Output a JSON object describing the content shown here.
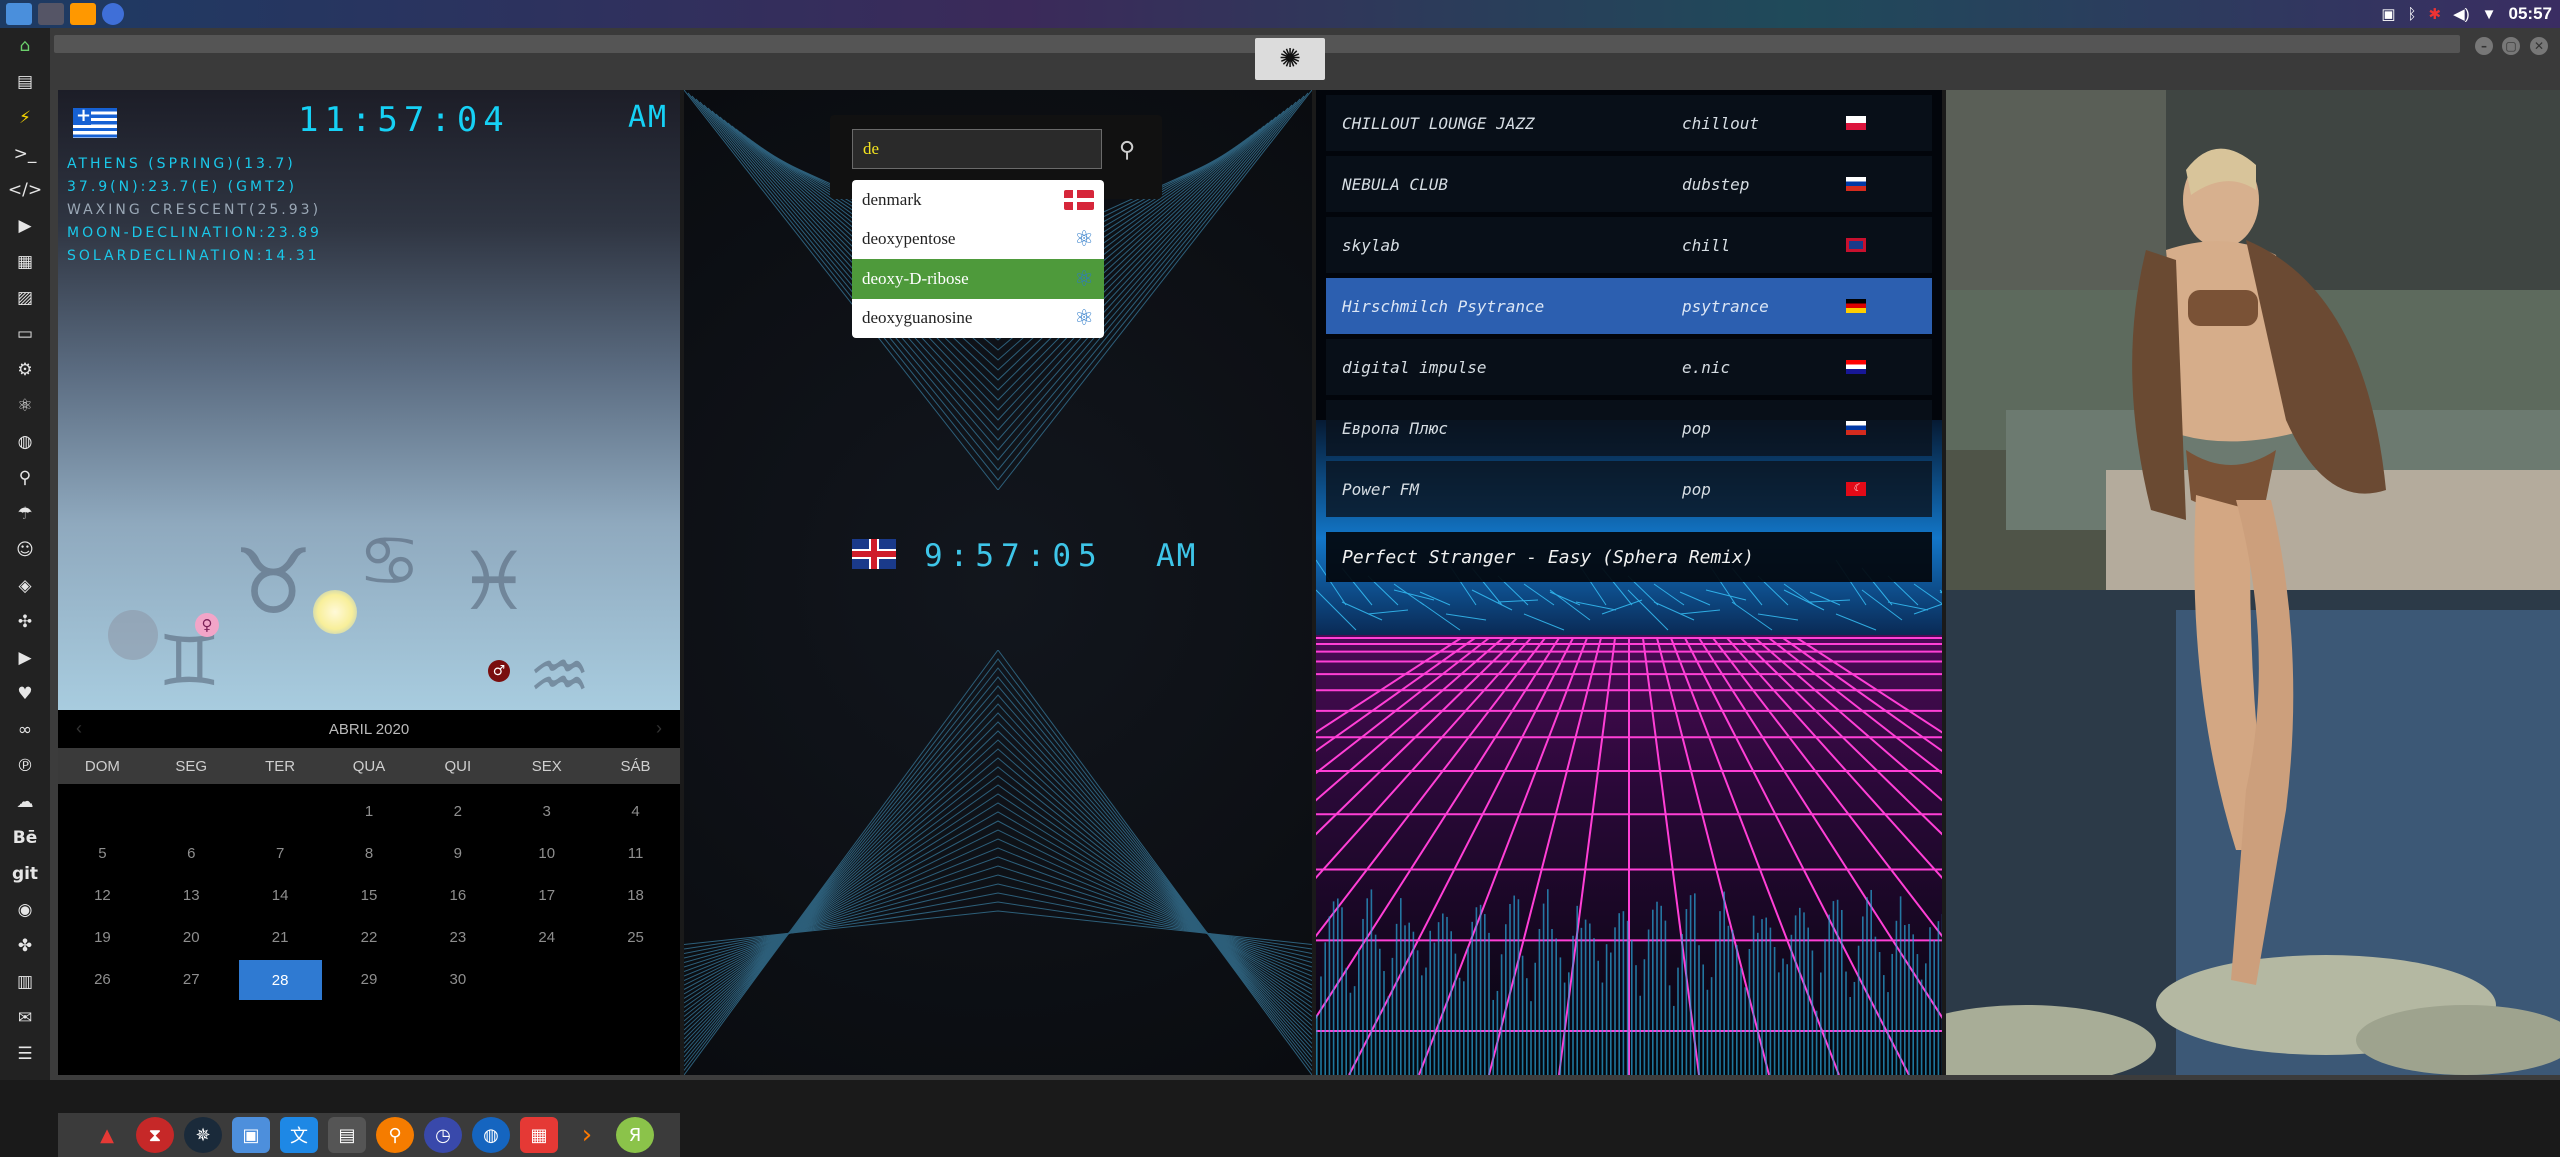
{
  "topbar": {
    "time": "05:57"
  },
  "astro": {
    "time": "11:57:04",
    "ampm": "AM",
    "lines": [
      "ATHENS (SPRING)(13.7)",
      "37.9(N):23.7(E) (GMT2)",
      "WAXING CRESCENT(25.93)",
      "MOON-DECLINATION:23.89",
      "SOLARDECLINATION:14.31"
    ]
  },
  "calendar": {
    "month_title": "ABRIL 2020",
    "weekdays": [
      "DOM",
      "SEG",
      "TER",
      "QUA",
      "QUI",
      "SEX",
      "SÁB"
    ],
    "days": [
      "",
      "",
      "",
      "1",
      "2",
      "3",
      "4",
      "5",
      "6",
      "7",
      "8",
      "9",
      "10",
      "11",
      "12",
      "13",
      "14",
      "15",
      "16",
      "17",
      "18",
      "19",
      "20",
      "21",
      "22",
      "23",
      "24",
      "25",
      "26",
      "27",
      "28",
      "29",
      "30",
      "",
      ""
    ],
    "today": "28"
  },
  "search": {
    "query": "de",
    "suggestions": [
      {
        "label": "denmark",
        "icon": "denmark-flag-icon"
      },
      {
        "label": "deoxypentose",
        "icon": "molecule-icon"
      },
      {
        "label": "deoxy-D-ribose",
        "icon": "molecule-icon"
      },
      {
        "label": "deoxyguanosine",
        "icon": "molecule-icon"
      }
    ],
    "active_index": 2
  },
  "uk_clock": {
    "time": "9:57:05",
    "ampm": "AM"
  },
  "radio": {
    "stations": [
      {
        "name": "CHILLOUT LOUNGE JAZZ",
        "genre": "chillout",
        "flag": "pl"
      },
      {
        "name": "NEBULA CLUB",
        "genre": "dubstep",
        "flag": "ru"
      },
      {
        "name": "skylab",
        "genre": "chill",
        "flag": "gb"
      },
      {
        "name": "Hirschmilch Psytrance",
        "genre": "psytrance",
        "flag": "de"
      },
      {
        "name": "digital impulse",
        "genre": "e.nic",
        "flag": "hr"
      },
      {
        "name": "Европа Плюс",
        "genre": "pop",
        "flag": "ru"
      },
      {
        "name": "Power FM",
        "genre": "pop",
        "flag": "tr"
      }
    ],
    "active_index": 3,
    "now_playing": "Perfect Stranger - Easy (Sphera Remix)"
  },
  "colors": {
    "accent_green": "#4e9a3b",
    "accent_blue": "#2f7ad2",
    "lcd_cyan": "#16d1f5",
    "neon_pink": "#ff3fd6"
  }
}
